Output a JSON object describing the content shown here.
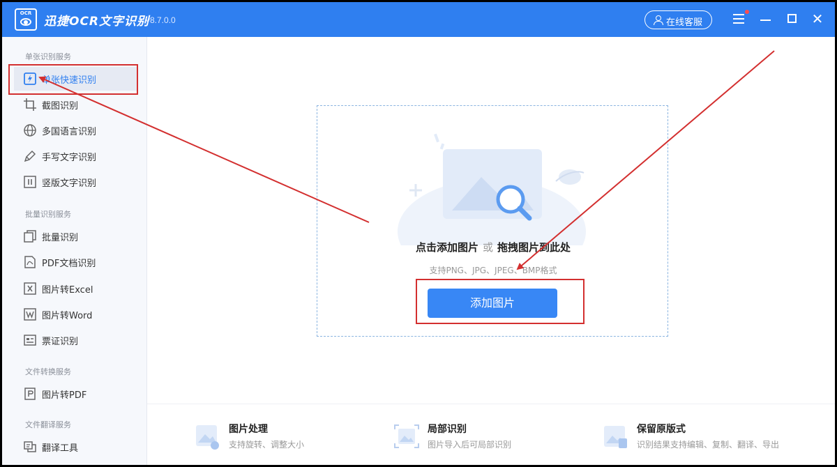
{
  "app": {
    "logo_text": "OCR",
    "title": "迅捷OCR文字识别",
    "version": "v8.7.0.0",
    "service_label": "在线客服"
  },
  "sidebar": {
    "sections": [
      {
        "title": "单张识别服务",
        "items": [
          {
            "label": "单张快速识别",
            "icon": "quick-recognize-icon",
            "active": true
          },
          {
            "label": "截图识别",
            "icon": "crop-icon"
          },
          {
            "label": "多国语言识别",
            "icon": "globe-icon"
          },
          {
            "label": "手写文字识别",
            "icon": "pen-icon"
          },
          {
            "label": "竖版文字识别",
            "icon": "vertical-text-icon"
          }
        ]
      },
      {
        "title": "批量识别服务",
        "items": [
          {
            "label": "批量识别",
            "icon": "batch-icon"
          },
          {
            "label": "PDF文档识别",
            "icon": "pdf-icon"
          },
          {
            "label": "图片转Excel",
            "icon": "excel-icon"
          },
          {
            "label": "图片转Word",
            "icon": "word-icon"
          },
          {
            "label": "票证识别",
            "icon": "ticket-icon"
          }
        ]
      },
      {
        "title": "文件转换服务",
        "items": [
          {
            "label": "图片转PDF",
            "icon": "pdf-convert-icon"
          }
        ]
      },
      {
        "title": "文件翻译服务",
        "items": [
          {
            "label": "翻译工具",
            "icon": "translate-icon"
          }
        ]
      }
    ]
  },
  "dropzone": {
    "title_click": "点击添加图片",
    "title_or": "或",
    "title_drag": "拖拽图片到此处",
    "formats": "支持PNG、JPG、JPEG、BMP格式",
    "add_button": "添加图片"
  },
  "features": [
    {
      "title": "图片处理",
      "desc": "支持旋转、调整大小",
      "icon": "image-process-icon"
    },
    {
      "title": "局部识别",
      "desc": "图片导入后可局部识别",
      "icon": "partial-recognize-icon"
    },
    {
      "title": "保留原版式",
      "desc": "识别结果支持编辑、复制、翻译、导出",
      "icon": "keep-layout-icon"
    }
  ],
  "colors": {
    "brand": "#2f7ff0",
    "button": "#3887f5",
    "annotation": "#d32f2f"
  }
}
